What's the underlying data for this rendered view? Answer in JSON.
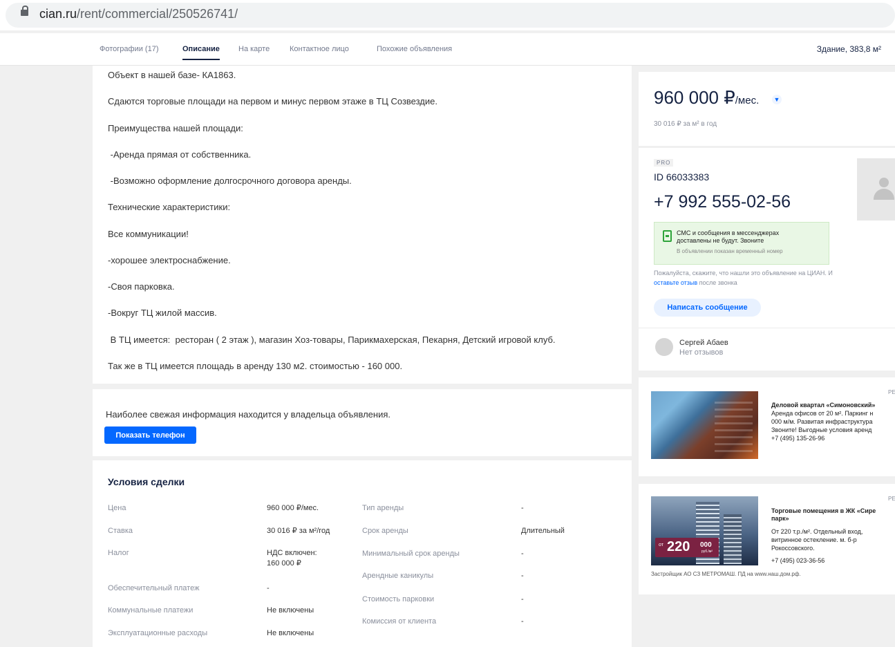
{
  "browser": {
    "url_host": "cian.ru",
    "url_path": "/rent/commercial/250526741/"
  },
  "nav": {
    "tabs": [
      "Фотографии (17)",
      "Описание",
      "На карте",
      "Контактное лицо",
      "Похожие объявления"
    ],
    "building": "Здание, 383,8 м²"
  },
  "description": {
    "lines": [
      "Объект в нашей базе- КА1863.",
      "Сдаются торговые площади на первом и минус первом этаже в ТЦ Созвездие.",
      "Преимущества нашей площади:",
      " -Аренда прямая от собственника.",
      " -Возможно оформление долгосрочного договора аренды.",
      "Технические характеристики:",
      "Все коммуникации!",
      "-хорошее электроснабжение.",
      "-Своя парковка.",
      "-Вокруг ТЦ жилой массив.",
      " В ТЦ имеется:  ресторан ( 2 этаж ), магазин Хоз-товары, Парикмахерская, Пекарня, Детский игровой клуб.",
      "Так же в ТЦ имеется площадь в аренду 130 м2. стоимостью - 160 000."
    ]
  },
  "owner_notice": {
    "text": "Наиболее свежая информация находится у владельца объявления.",
    "button": "Показать телефон"
  },
  "deal": {
    "title": "Условия сделки",
    "left": [
      {
        "k": "Цена",
        "v": "960 000 ₽/мес."
      },
      {
        "k": "Ставка",
        "v": "30 016 ₽ за м²/год"
      },
      {
        "k": "Налог",
        "v": "НДС включен: 160 000 ₽"
      },
      {
        "k": "Обеспечительный платеж",
        "v": "-"
      },
      {
        "k": "Коммунальные платежи",
        "v": "Не включены"
      },
      {
        "k": "Эксплуатационные расходы",
        "v": "Не включены"
      }
    ],
    "right": [
      {
        "k": "Тип аренды",
        "v": "-"
      },
      {
        "k": "Срок аренды",
        "v": "Длительный"
      },
      {
        "k": "Минимальный срок аренды",
        "v": "-"
      },
      {
        "k": "Арендные каникулы",
        "v": "-"
      },
      {
        "k": "Стоимость парковки",
        "v": "-"
      },
      {
        "k": "Комиссия от клиента",
        "v": "-"
      }
    ]
  },
  "price": {
    "amount": "960 000 ₽",
    "unit": "/мес.",
    "per_m2": "30 016 ₽ за м² в год"
  },
  "contact": {
    "badge": "PRO",
    "id": "ID 66033383",
    "phone": "+7 992 555-02-56",
    "sms_line1": "СМС и сообщения в мессенджерах",
    "sms_line2": "доставлены не будут. Звоните",
    "sms_note": "В объявлении показан временный номер",
    "please_text": "Пожалуйста, скажите, что нашли это объявление на ЦИАН. И",
    "please_link": "оставьте отзыв",
    "please_tail": "после звонка",
    "message_button": "Написать сообщение",
    "agent_name": "Сергей Абаев",
    "agent_reviews": "Нет отзывов"
  },
  "ad1": {
    "tag": "РЕ",
    "lines": [
      "Деловой квартал «Симоновский»",
      "Аренда офисов от 20 м². Паркинг н",
      "000 м/м. Развитая инфраструктура",
      "Звоните! Выгодные условия аренд",
      "+7 (495) 135-26-96"
    ]
  },
  "ad2": {
    "tag": "РЕ",
    "badge_prefix": "от",
    "badge_number": "220",
    "badge_suffix": "000",
    "badge_unit": "руб./м²",
    "lines": [
      "Торговые помещения в ЖК «Сире",
      "парк»",
      "От 220 т.р./м². Отдельный вход,",
      "витринное остекление. м. б-р",
      "Рокоссовского.",
      "+7 (495) 023-36-56"
    ],
    "footer": "Застройщик АО СЗ МЕТРОМАШ. ПД на www.наш.дом.рф."
  }
}
